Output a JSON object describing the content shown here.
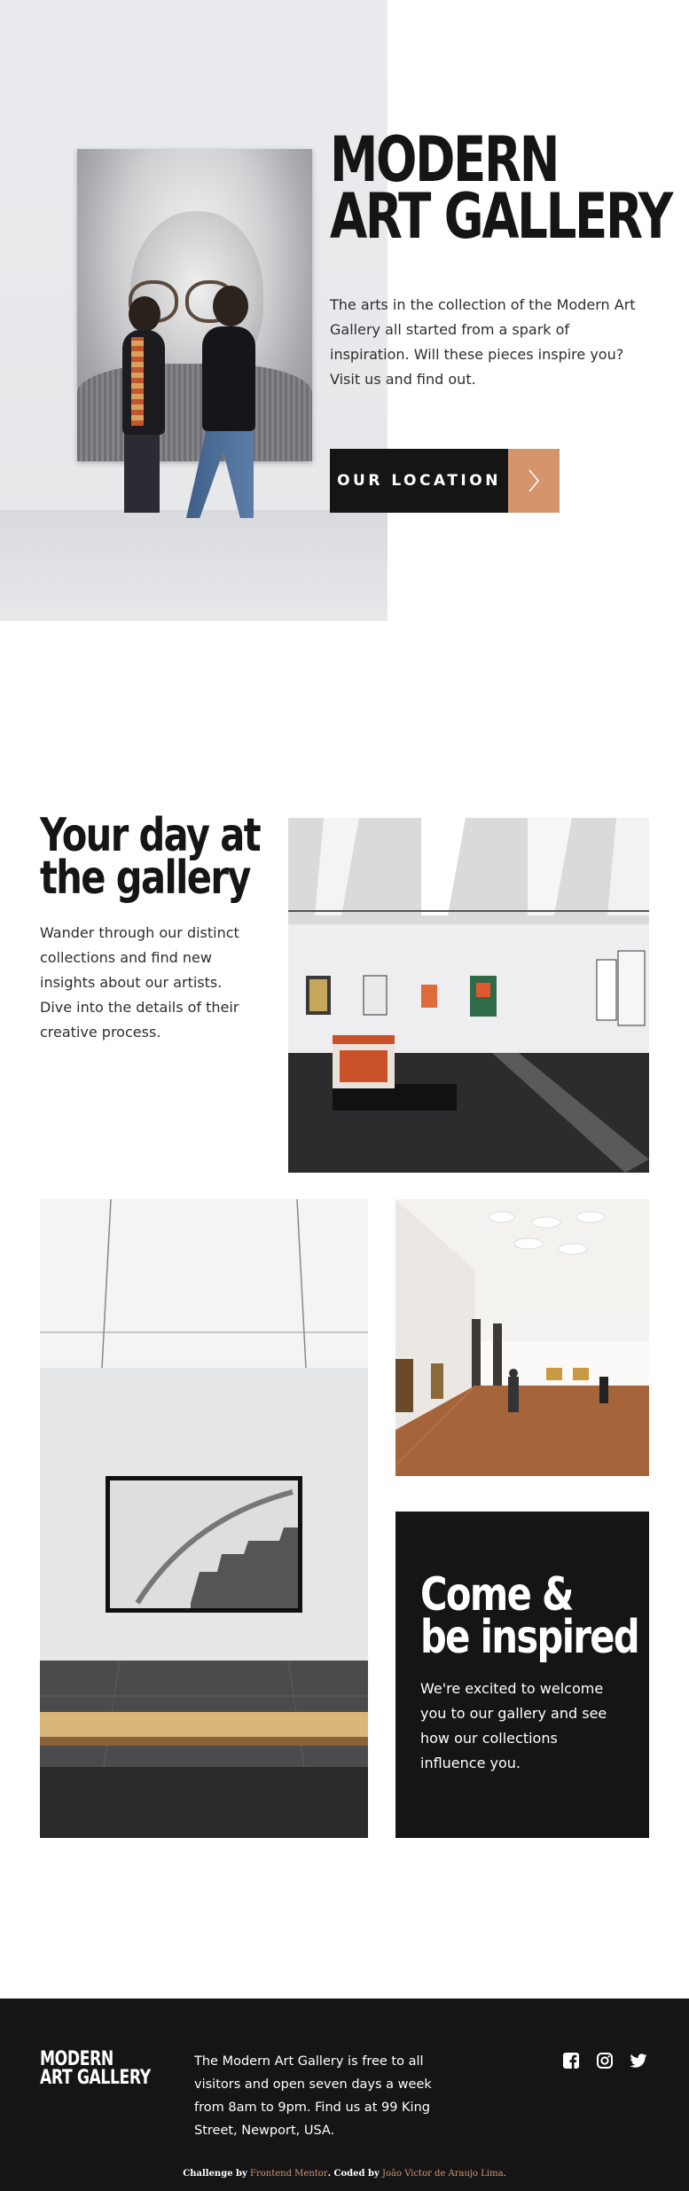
{
  "hero": {
    "title_line1": "MODERN",
    "title_line2": "ART GALLERY",
    "description": "The arts in the collection of the Modern Art Gallery all started from a spark of inspiration. Will these pieces inspire you? Visit us and find out.",
    "cta_label": "OUR LOCATION",
    "cta_icon": "chevron-right-icon"
  },
  "intro": {
    "title_line1": "Your day at",
    "title_line2": "the gallery",
    "text": "Wander through our distinct collections and find new insights about our artists. Dive into the details of their creative process."
  },
  "inspired": {
    "title_line1": "Come &",
    "title_line2": "be inspired",
    "text": "We're excited to welcome you to our gallery and see how our collections influence you."
  },
  "footer": {
    "logo_line1": "MODERN",
    "logo_line2": "ART GALLERY",
    "text": "The Modern Art Gallery is free to all visitors and open seven days a week from 8am to 9pm. Find us at 99 King Street, Newport, USA.",
    "socials": [
      "facebook-icon",
      "instagram-icon",
      "twitter-icon"
    ],
    "attribution": {
      "challenge_prefix": "Challenge by",
      "challenge_link": "Frontend Mentor",
      "coded_prefix": ". Coded by",
      "coded_link": "João Victor de Araujo Lima",
      "suffix": "."
    }
  },
  "colors": {
    "dark": "#151515",
    "accent": "#d5946c",
    "white": "#ffffff"
  }
}
